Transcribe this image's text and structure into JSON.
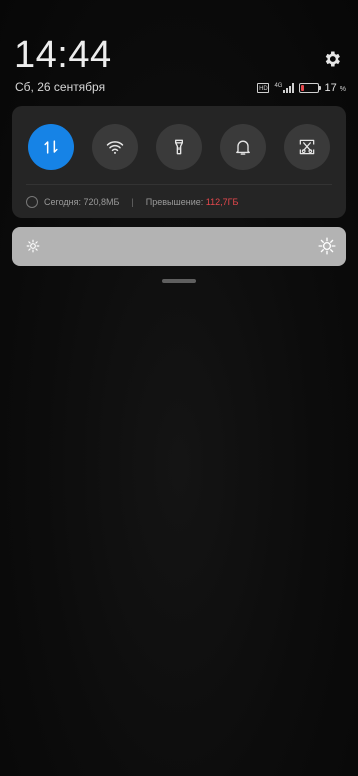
{
  "status": {
    "time": "14:44",
    "date": "Сб, 26 сентября",
    "sim_label": "HD",
    "network": "4G",
    "battery_percent_text": "17",
    "battery_unit": "%",
    "battery_level": 0.17,
    "battery_color": "#e5484d",
    "settings_icon": "gear-icon"
  },
  "quick_tiles": [
    {
      "name": "mobile-data",
      "icon": "arrows-updown-icon",
      "active": true
    },
    {
      "name": "wifi",
      "icon": "wifi-icon",
      "active": false
    },
    {
      "name": "flashlight",
      "icon": "flashlight-icon",
      "active": false
    },
    {
      "name": "sound",
      "icon": "bell-icon",
      "active": false
    },
    {
      "name": "screenshot",
      "icon": "scissors-screenshot-icon",
      "active": false
    }
  ],
  "usage": {
    "today_label": "Сегодня: 720,8МБ",
    "separator": "|",
    "exceed_label": "Превышение: ",
    "exceed_value": "112,7ГБ"
  },
  "brightness": {
    "level": 1.0,
    "low_icon": "sun-small-icon",
    "high_icon": "sun-large-icon"
  },
  "colors": {
    "accent": "#1683e6",
    "panel": "#252525",
    "tile": "#3a3a3a",
    "slider": "#b3b3b3",
    "warning": "#e5484d"
  }
}
